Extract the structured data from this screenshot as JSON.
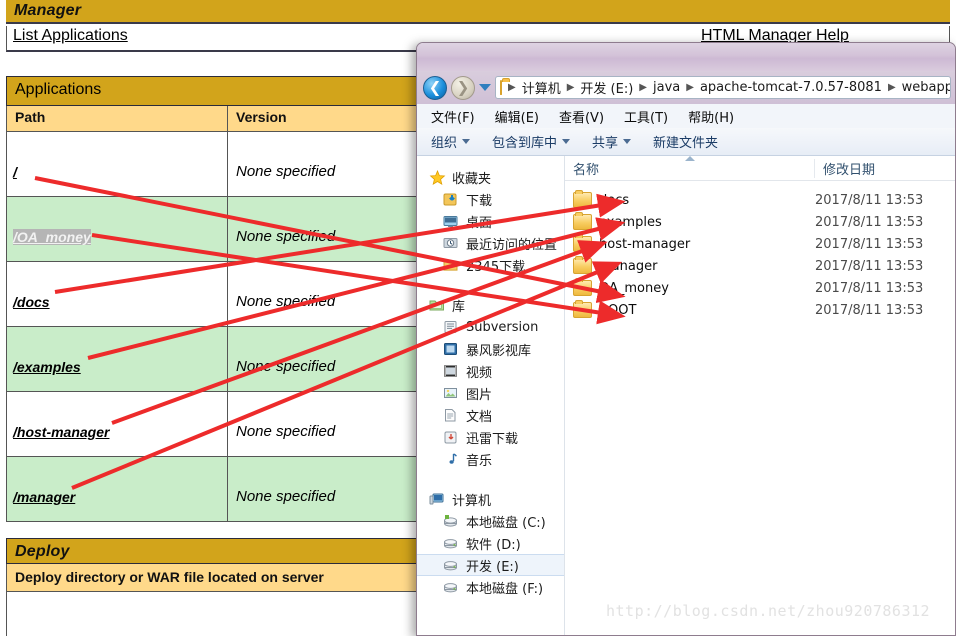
{
  "tomcat": {
    "header_title": "Manager",
    "links": {
      "list_applications": "List Applications",
      "html_manager_help": "HTML Manager Help"
    },
    "applications": {
      "section_title": "Applications",
      "columns": [
        "Path",
        "Version"
      ],
      "rows": [
        {
          "path": "/",
          "version": "None specified",
          "selected": false
        },
        {
          "path": "/OA_money",
          "version": "None specified",
          "selected": true
        },
        {
          "path": "/docs",
          "version": "None specified",
          "selected": false
        },
        {
          "path": "/examples",
          "version": "None specified",
          "selected": false
        },
        {
          "path": "/host-manager",
          "version": "None specified",
          "selected": false
        },
        {
          "path": "/manager",
          "version": "None specified",
          "selected": false
        }
      ]
    },
    "deploy": {
      "section_title": "Deploy",
      "subsection_title": "Deploy directory or WAR file located on server"
    }
  },
  "explorer": {
    "nav": {
      "back_icon": "back-arrow-icon",
      "forward_icon": "forward-arrow-icon",
      "recent_icon": "chevron-down-icon"
    },
    "breadcrumb": [
      "计算机",
      "开发 (E:)",
      "java",
      "apache-tomcat-7.0.57-8081",
      "webapps"
    ],
    "menubar": [
      "文件(F)",
      "编辑(E)",
      "查看(V)",
      "工具(T)",
      "帮助(H)"
    ],
    "toolbar": [
      {
        "label": "组织",
        "dropdown": true
      },
      {
        "label": "包含到库中",
        "dropdown": true
      },
      {
        "label": "共享",
        "dropdown": true
      },
      {
        "label": "新建文件夹",
        "dropdown": false
      }
    ],
    "nav_pane": {
      "groups": [
        {
          "header": {
            "label": "收藏夹",
            "icon": "star-icon"
          },
          "items": [
            {
              "label": "下载",
              "icon": "downloads-icon"
            },
            {
              "label": "桌面",
              "icon": "desktop-icon"
            },
            {
              "label": "最近访问的位置",
              "icon": "recent-places-icon"
            },
            {
              "label": "2345下载",
              "icon": "folder-icon"
            }
          ]
        },
        {
          "header": {
            "label": "库",
            "icon": "library-icon"
          },
          "items": [
            {
              "label": "Subversion",
              "icon": "subversion-icon"
            },
            {
              "label": "暴风影视库",
              "icon": "video-library-icon"
            },
            {
              "label": "视频",
              "icon": "videos-icon"
            },
            {
              "label": "图片",
              "icon": "pictures-icon"
            },
            {
              "label": "文档",
              "icon": "documents-icon"
            },
            {
              "label": "迅雷下载",
              "icon": "thunder-download-icon"
            },
            {
              "label": "音乐",
              "icon": "music-icon"
            }
          ]
        },
        {
          "header": {
            "label": "计算机",
            "icon": "computer-icon"
          },
          "items": [
            {
              "label": "本地磁盘 (C:)",
              "icon": "system-drive-icon",
              "selected": false
            },
            {
              "label": "软件 (D:)",
              "icon": "drive-icon",
              "selected": false
            },
            {
              "label": "开发 (E:)",
              "icon": "drive-icon",
              "selected": true
            },
            {
              "label": "本地磁盘 (F:)",
              "icon": "drive-icon",
              "selected": false
            }
          ]
        }
      ]
    },
    "list": {
      "columns": [
        "名称",
        "修改日期"
      ],
      "files": [
        {
          "name": "docs",
          "date": "2017/8/11 13:53",
          "icon": "folder-icon"
        },
        {
          "name": "examples",
          "date": "2017/8/11 13:53",
          "icon": "folder-icon"
        },
        {
          "name": "host-manager",
          "date": "2017/8/11 13:53",
          "icon": "folder-icon"
        },
        {
          "name": "manager",
          "date": "2017/8/11 13:53",
          "icon": "folder-icon"
        },
        {
          "name": "OA_money",
          "date": "2017/8/11 13:53",
          "icon": "folder-icon"
        },
        {
          "name": "ROOT",
          "date": "2017/8/11 13:53",
          "icon": "folder-icon"
        }
      ]
    }
  },
  "watermark": "http://blog.csdn.net/zhou920786312",
  "colors": {
    "band_gold": "#D2A41B",
    "subheader_gold": "#FFD98A",
    "row_green": "#C9EDC9",
    "arrow_red": "#ED2B2B",
    "selection_gray": "#b5b5b5"
  },
  "annotations": {
    "type": "arrows",
    "description": "Red arrows mapping Tomcat application paths to webapps folders",
    "arrows": [
      {
        "from": "/",
        "to": "OA_money"
      },
      {
        "from": "/OA_money",
        "to": "ROOT"
      },
      {
        "from": "/docs",
        "to": "examples"
      },
      {
        "from": "/examples",
        "to": "docs"
      },
      {
        "from": "/host-manager",
        "to": "host-manager"
      },
      {
        "from": "/manager",
        "to": "manager"
      }
    ]
  }
}
